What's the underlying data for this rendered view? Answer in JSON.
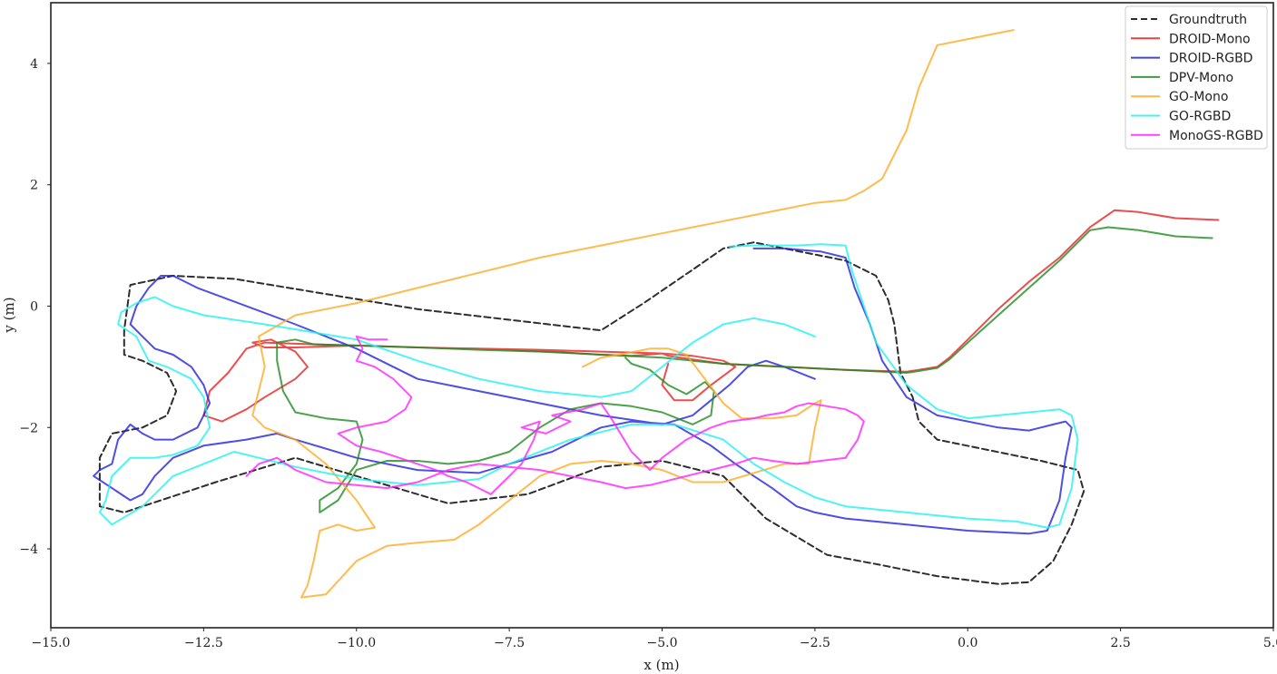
{
  "chart_data": {
    "type": "line",
    "title": "",
    "xlabel": "x (m)",
    "ylabel": "y (m)",
    "xlim": [
      -15.0,
      5.0
    ],
    "ylim": [
      -5.3,
      5.0
    ],
    "xticks": [
      -15.0,
      -12.5,
      -10.0,
      -7.5,
      -5.0,
      -2.5,
      0.0,
      2.5,
      5.0
    ],
    "xtick_labels": [
      "−15.0",
      "−12.5",
      "−10.0",
      "−7.5",
      "−5.0",
      "−2.5",
      "0.0",
      "2.5",
      "5.0"
    ],
    "yticks": [
      4,
      2,
      0,
      -2,
      -4
    ],
    "ytick_labels": [
      "4",
      "2",
      "0",
      "−2",
      "−4"
    ],
    "grid": false,
    "legend_position": "top-right",
    "series": [
      {
        "name": "Groundtruth",
        "color": "#222222",
        "style": "dashed",
        "x": [
          -3.5,
          -4.0,
          -4.5,
          -5.3,
          -6.0,
          -9.0,
          -12.0,
          -13.0,
          -13.7,
          -13.8,
          -13.8,
          -13.5,
          -13.1,
          -12.95,
          -13.1,
          -13.5,
          -14.0,
          -14.2,
          -14.2,
          -13.8,
          -13.5,
          -12.3,
          -11.0,
          -10.0,
          -8.5,
          -7.2,
          -6.0,
          -5.0,
          -4.0,
          -3.3,
          -2.3,
          -1.5,
          -0.5,
          0.5,
          1.0,
          1.4,
          1.7,
          1.9,
          1.8,
          1.2,
          -0.5,
          -0.8,
          -0.9,
          -1.1,
          -1.2,
          -1.3,
          -1.5,
          -2.0,
          -3.0,
          -3.5
        ],
        "y": [
          1.05,
          0.95,
          0.6,
          0.05,
          -0.4,
          -0.05,
          0.45,
          0.5,
          0.35,
          -0.4,
          -0.8,
          -0.9,
          -1.1,
          -1.4,
          -1.8,
          -2.0,
          -2.1,
          -2.5,
          -3.3,
          -3.4,
          -3.3,
          -2.9,
          -2.5,
          -2.8,
          -3.25,
          -3.1,
          -2.65,
          -2.55,
          -2.8,
          -3.5,
          -4.1,
          -4.25,
          -4.45,
          -4.58,
          -4.55,
          -4.2,
          -3.6,
          -3.05,
          -2.7,
          -2.55,
          -2.2,
          -1.9,
          -1.5,
          -1.1,
          -0.3,
          0.1,
          0.5,
          0.75,
          0.95,
          1.05
        ]
      },
      {
        "name": "DROID-Mono",
        "color": "#e62222",
        "style": "solid",
        "x": [
          4.1,
          3.4,
          2.8,
          2.4,
          2.0,
          1.5,
          1.0,
          0.5,
          0.0,
          -0.3,
          -0.5,
          -0.8,
          -1.0,
          -2.0,
          -3.0,
          -4.0,
          -4.5,
          -4.9,
          -5.0,
          -5.5,
          -6.0,
          -6.8,
          -8.0,
          -9.0,
          -10.0,
          -11.0,
          -11.5,
          -11.7,
          -11.4,
          -11.0,
          -10.8,
          -11.0,
          -11.5,
          -11.8,
          -12.2,
          -12.5,
          -12.4,
          -12.1,
          -11.8,
          -11.5,
          -11.0,
          -10.0,
          -9.0,
          -8.0,
          -7.0,
          -6.0,
          -5.0,
          -4.5,
          -4.0,
          -3.8,
          -4.2,
          -4.5,
          -4.8,
          -5.0,
          -4.9
        ],
        "y": [
          1.42,
          1.45,
          1.55,
          1.58,
          1.3,
          0.8,
          0.4,
          -0.05,
          -0.55,
          -0.85,
          -1.0,
          -1.05,
          -1.08,
          -1.05,
          -1.0,
          -0.95,
          -0.88,
          -0.82,
          -0.78,
          -0.82,
          -0.8,
          -0.75,
          -0.7,
          -0.68,
          -0.65,
          -0.68,
          -0.68,
          -0.6,
          -0.55,
          -0.75,
          -1.0,
          -1.2,
          -1.5,
          -1.7,
          -1.9,
          -1.8,
          -1.4,
          -1.1,
          -0.7,
          -0.6,
          -0.62,
          -0.65,
          -0.68,
          -0.7,
          -0.72,
          -0.75,
          -0.78,
          -0.82,
          -0.9,
          -1.0,
          -1.3,
          -1.55,
          -1.55,
          -1.3,
          -0.95
        ]
      },
      {
        "name": "DROID-RGBD",
        "color": "#2222dd",
        "style": "solid",
        "x": [
          -3.5,
          -3.0,
          -2.4,
          -2.2,
          -2.0,
          -1.85,
          -1.6,
          -1.4,
          -1.0,
          -0.5,
          0.5,
          1.0,
          1.4,
          1.6,
          1.7,
          1.6,
          1.5,
          1.3,
          1.0,
          0.0,
          -1.0,
          -2.0,
          -2.5,
          -2.8,
          -3.2,
          -3.8,
          -4.2,
          -4.8,
          -5.5,
          -6.0,
          -6.8,
          -7.5,
          -8.0,
          -9.0,
          -10.0,
          -11.0,
          -11.3,
          -11.8,
          -12.5,
          -13.0,
          -13.3,
          -13.5,
          -13.7,
          -14.0,
          -14.3,
          -14.2,
          -14.0,
          -13.9,
          -13.7,
          -13.5,
          -13.3,
          -13.0,
          -12.6,
          -12.4,
          -12.5,
          -12.7,
          -13.0,
          -13.3,
          -13.5,
          -13.7,
          -13.6,
          -13.4,
          -13.2,
          -13.0,
          -12.6,
          -12.2,
          -11.0,
          -10.0,
          -9.0,
          -8.0,
          -7.0,
          -6.0,
          -5.0,
          -4.5,
          -4.2,
          -3.9,
          -3.6,
          -3.3,
          -3.0,
          -2.5
        ],
        "y": [
          0.95,
          0.95,
          0.9,
          0.85,
          0.8,
          0.3,
          -0.3,
          -0.9,
          -1.5,
          -1.8,
          -2.0,
          -2.05,
          -1.95,
          -1.9,
          -2.0,
          -2.5,
          -3.2,
          -3.7,
          -3.75,
          -3.7,
          -3.6,
          -3.5,
          -3.4,
          -3.3,
          -3.0,
          -2.6,
          -2.3,
          -1.95,
          -1.9,
          -2.0,
          -2.4,
          -2.6,
          -2.75,
          -2.7,
          -2.5,
          -2.2,
          -2.1,
          -2.2,
          -2.3,
          -2.5,
          -2.8,
          -3.1,
          -3.2,
          -3.0,
          -2.8,
          -2.7,
          -2.6,
          -2.2,
          -1.95,
          -2.1,
          -2.2,
          -2.2,
          -2.0,
          -1.6,
          -1.3,
          -1.0,
          -0.8,
          -0.7,
          -0.5,
          -0.3,
          0.0,
          0.3,
          0.5,
          0.5,
          0.3,
          0.15,
          -0.3,
          -0.7,
          -1.2,
          -1.4,
          -1.6,
          -1.8,
          -1.95,
          -1.8,
          -1.55,
          -1.3,
          -1.0,
          -0.9,
          -1.0,
          -1.2
        ]
      },
      {
        "name": "DPV-Mono",
        "color": "#1f8a1f",
        "style": "solid",
        "x": [
          4.0,
          3.4,
          2.8,
          2.3,
          2.0,
          1.5,
          1.0,
          0.5,
          0.0,
          -0.3,
          -0.5,
          -0.8,
          -1.0,
          -2.0,
          -3.0,
          -4.0,
          -4.5,
          -5.0,
          -6.0,
          -7.0,
          -8.0,
          -9.0,
          -10.0,
          -10.7,
          -11.0,
          -11.3,
          -11.3,
          -11.2,
          -11.0,
          -10.5,
          -10.0,
          -9.9,
          -10.0,
          -10.3,
          -10.6,
          -10.6,
          -10.3,
          -10.0,
          -9.5,
          -9.0,
          -8.5,
          -8.0,
          -7.5,
          -7.0,
          -6.5,
          -6.0,
          -5.5,
          -5.0,
          -4.5,
          -4.2,
          -4.15,
          -4.3,
          -4.6,
          -4.9,
          -5.2,
          -5.5,
          -5.6
        ],
        "y": [
          1.12,
          1.15,
          1.25,
          1.3,
          1.25,
          0.75,
          0.3,
          -0.15,
          -0.6,
          -0.88,
          -1.02,
          -1.07,
          -1.1,
          -1.05,
          -1.0,
          -0.95,
          -0.9,
          -0.85,
          -0.8,
          -0.75,
          -0.72,
          -0.68,
          -0.65,
          -0.63,
          -0.55,
          -0.6,
          -0.9,
          -1.4,
          -1.75,
          -1.85,
          -1.9,
          -2.2,
          -2.6,
          -3.0,
          -3.2,
          -3.4,
          -3.2,
          -2.7,
          -2.55,
          -2.55,
          -2.6,
          -2.55,
          -2.4,
          -2.0,
          -1.7,
          -1.6,
          -1.65,
          -1.75,
          -1.95,
          -1.8,
          -1.4,
          -1.25,
          -1.45,
          -1.3,
          -1.05,
          -0.95,
          -0.85
        ]
      },
      {
        "name": "GO-Mono",
        "color": "#ffaa22",
        "style": "solid",
        "x": [
          0.75,
          0.5,
          0.0,
          -0.5,
          -0.8,
          -1.0,
          -1.2,
          -1.4,
          -1.7,
          -1.9,
          -2.0,
          -2.5,
          -3.0,
          -3.5,
          -4.0,
          -5.0,
          -6.0,
          -7.0,
          -8.0,
          -9.0,
          -10.0,
          -11.0,
          -11.6,
          -11.5,
          -11.7,
          -11.5,
          -11.0,
          -10.5,
          -10.0,
          -9.8,
          -9.7,
          -10.0,
          -10.3,
          -10.6,
          -10.7,
          -10.8,
          -10.9,
          -10.5,
          -10.0,
          -9.5,
          -9.0,
          -8.4,
          -8.0,
          -7.5,
          -7.0,
          -6.5,
          -6.0,
          -5.5,
          -5.0,
          -4.5,
          -4.0,
          -3.5,
          -3.0,
          -2.6,
          -2.5,
          -2.4,
          -2.5,
          -2.8,
          -3.2,
          -3.7,
          -4.0,
          -4.3,
          -4.6,
          -4.9,
          -5.2,
          -5.7,
          -6.0,
          -6.3
        ],
        "y": [
          4.55,
          4.5,
          4.4,
          4.3,
          3.6,
          2.9,
          2.5,
          2.1,
          1.9,
          1.8,
          1.75,
          1.7,
          1.6,
          1.5,
          1.4,
          1.2,
          1.0,
          0.8,
          0.55,
          0.3,
          0.05,
          -0.15,
          -0.5,
          -1.0,
          -1.8,
          -2.0,
          -2.2,
          -2.6,
          -3.2,
          -3.5,
          -3.65,
          -3.7,
          -3.6,
          -3.7,
          -4.2,
          -4.6,
          -4.8,
          -4.75,
          -4.2,
          -3.95,
          -3.9,
          -3.85,
          -3.6,
          -3.2,
          -2.8,
          -2.6,
          -2.55,
          -2.6,
          -2.7,
          -2.9,
          -2.9,
          -2.75,
          -2.6,
          -2.6,
          -2.0,
          -1.55,
          -1.6,
          -1.8,
          -1.85,
          -1.85,
          -1.6,
          -1.2,
          -0.8,
          -0.7,
          -0.7,
          -0.8,
          -0.85,
          -1.0
        ]
      },
      {
        "name": "GO-RGBD",
        "color": "#22f0f0",
        "style": "solid",
        "x": [
          -3.9,
          -3.5,
          -2.8,
          -2.4,
          -2.0,
          -1.9,
          -1.7,
          -1.5,
          -1.0,
          -0.5,
          0.0,
          0.5,
          1.0,
          1.5,
          1.7,
          1.8,
          1.7,
          1.5,
          1.3,
          0.8,
          0.0,
          -1.0,
          -2.0,
          -2.5,
          -3.0,
          -3.5,
          -4.0,
          -4.8,
          -5.5,
          -6.5,
          -7.5,
          -8.0,
          -9.0,
          -10.0,
          -11.0,
          -12.0,
          -13.0,
          -13.5,
          -14.0,
          -14.2,
          -14.1,
          -14.0,
          -13.7,
          -13.3,
          -13.0,
          -12.6,
          -12.4,
          -12.5,
          -12.7,
          -13.1,
          -13.4,
          -13.5,
          -13.6,
          -13.9,
          -13.85,
          -13.6,
          -13.3,
          -13.0,
          -12.5,
          -11.5,
          -10.0,
          -9.0,
          -8.0,
          -7.0,
          -6.0,
          -5.5,
          -5.0,
          -4.5,
          -4.0,
          -3.5,
          -3.0,
          -2.5
        ],
        "y": [
          0.98,
          1.0,
          1.0,
          1.02,
          1.0,
          0.6,
          0.0,
          -0.6,
          -1.3,
          -1.7,
          -1.85,
          -1.8,
          -1.75,
          -1.7,
          -1.8,
          -2.2,
          -3.0,
          -3.6,
          -3.65,
          -3.55,
          -3.5,
          -3.4,
          -3.3,
          -3.15,
          -2.9,
          -2.6,
          -2.2,
          -1.95,
          -1.95,
          -2.2,
          -2.6,
          -2.85,
          -2.95,
          -2.85,
          -2.65,
          -2.4,
          -2.8,
          -3.3,
          -3.6,
          -3.4,
          -3.2,
          -2.8,
          -2.5,
          -2.5,
          -2.45,
          -2.3,
          -2.0,
          -1.5,
          -1.2,
          -1.0,
          -0.9,
          -0.7,
          -0.5,
          -0.3,
          -0.1,
          0.05,
          0.15,
          0.0,
          -0.15,
          -0.3,
          -0.55,
          -0.9,
          -1.2,
          -1.4,
          -1.5,
          -1.4,
          -1.0,
          -0.6,
          -0.3,
          -0.2,
          -0.3,
          -0.5
        ]
      },
      {
        "name": "MonoGS-RGBD",
        "color": "#ff22ff",
        "style": "solid",
        "x": [
          -9.5,
          -9.8,
          -10.0,
          -9.9,
          -10.0,
          -9.7,
          -9.4,
          -9.2,
          -9.1,
          -9.2,
          -9.5,
          -10.0,
          -10.3,
          -10.0,
          -9.6,
          -9.3,
          -9.0,
          -8.7,
          -8.5,
          -8.2,
          -8.0,
          -7.8,
          -7.6,
          -7.3,
          -7.1,
          -7.0,
          -7.3,
          -6.9,
          -6.5,
          -6.8,
          -6.3,
          -6.0,
          -5.8,
          -5.5,
          -5.2,
          -5.0,
          -4.6,
          -4.2,
          -3.9,
          -3.5,
          -3.3,
          -3.0,
          -2.9,
          -2.8,
          -2.6,
          -2.3,
          -2.0,
          -1.8,
          -1.7,
          -1.8,
          -2.0,
          -2.4,
          -2.8,
          -3.2,
          -3.5,
          -3.8,
          -4.2,
          -4.8,
          -5.2,
          -5.6,
          -6.0,
          -6.5,
          -7.0,
          -7.5,
          -8.0,
          -8.5,
          -9.0,
          -9.5,
          -10.0,
          -10.5,
          -11.0,
          -11.3,
          -11.6,
          -11.8
        ],
        "y": [
          -0.55,
          -0.55,
          -0.5,
          -0.7,
          -0.9,
          -1.0,
          -1.2,
          -1.4,
          -1.5,
          -1.7,
          -1.9,
          -2.0,
          -2.1,
          -2.3,
          -2.4,
          -2.5,
          -2.6,
          -2.7,
          -2.8,
          -2.9,
          -3.0,
          -3.1,
          -2.9,
          -2.6,
          -2.2,
          -1.9,
          -2.0,
          -2.1,
          -1.9,
          -1.8,
          -1.7,
          -1.6,
          -1.9,
          -2.4,
          -2.7,
          -2.5,
          -2.2,
          -2.0,
          -1.9,
          -1.85,
          -1.8,
          -1.75,
          -1.7,
          -1.65,
          -1.6,
          -1.65,
          -1.7,
          -1.8,
          -1.9,
          -2.2,
          -2.5,
          -2.55,
          -2.6,
          -2.55,
          -2.5,
          -2.6,
          -2.7,
          -2.85,
          -2.95,
          -3.0,
          -2.9,
          -2.8,
          -2.7,
          -2.65,
          -2.6,
          -2.7,
          -2.9,
          -3.0,
          -2.95,
          -2.9,
          -2.7,
          -2.5,
          -2.6,
          -2.8
        ]
      }
    ]
  }
}
